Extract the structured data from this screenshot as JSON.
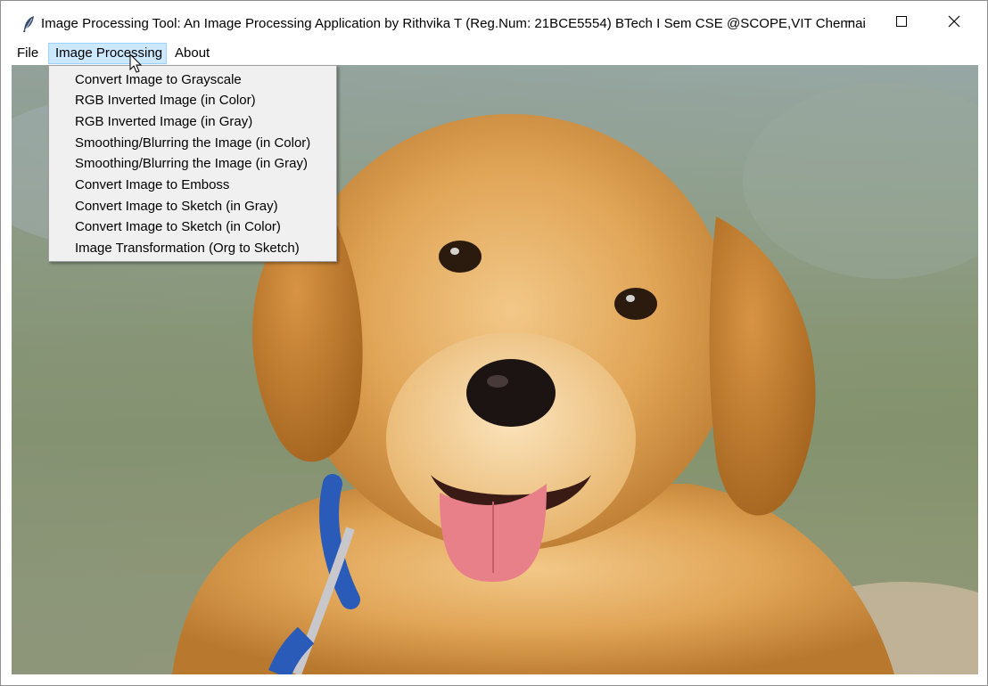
{
  "window": {
    "title": "Image Processing Tool: An Image Processing Application by Rithvika T (Reg.Num: 21BCE5554) BTech I Sem CSE @SCOPE,VIT Chennai",
    "app_icon": "feather-icon",
    "controls": {
      "minimize": "minimize-icon",
      "maximize": "maximize-icon",
      "close": "close-icon"
    }
  },
  "menubar": {
    "items": [
      "File",
      "Image Processing",
      "About"
    ],
    "active_index": 1
  },
  "dropdown": {
    "items": [
      "Convert Image to Grayscale",
      "RGB Inverted Image (in Color)",
      "RGB Inverted Image (in Gray)",
      "Smoothing/Blurring the Image (in Color)",
      "Smoothing/Blurring the Image (in Gray)",
      "Convert Image to Emboss",
      "Convert Image to Sketch (in Gray)",
      "Convert Image to Sketch (in Color)",
      "Image Transformation (Org to Sketch)"
    ]
  },
  "canvas": {
    "image": "golden-retriever-puppy"
  },
  "colors": {
    "menu_highlight": "#cce8ff",
    "menu_highlight_border": "#99d1ff",
    "dropdown_bg": "#f0f0f0"
  }
}
